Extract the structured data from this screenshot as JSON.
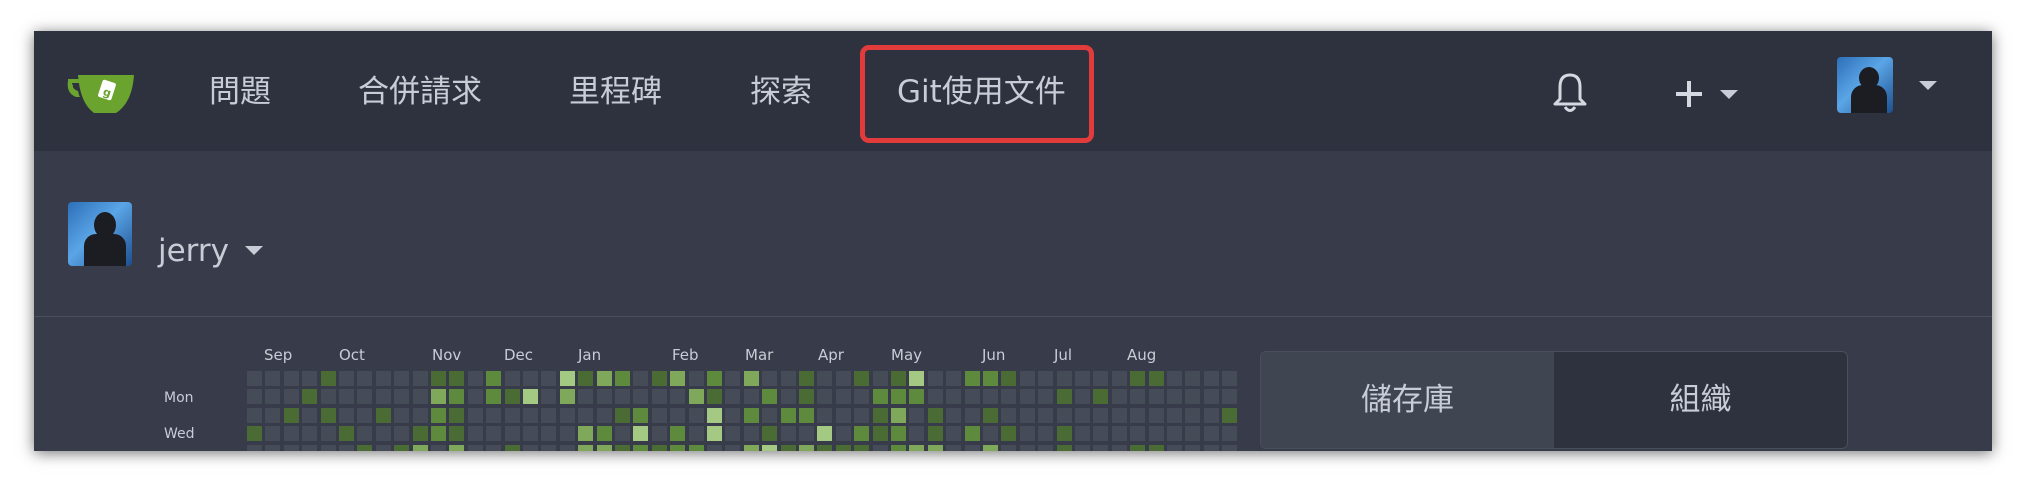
{
  "navbar": {
    "logo_icon": "gitea-teacup-icon",
    "items": [
      {
        "label": "問題"
      },
      {
        "label": "合併請求"
      },
      {
        "label": "里程碑"
      },
      {
        "label": "探索"
      },
      {
        "label": "Git使用文件",
        "highlighted": true
      }
    ],
    "notification_icon": "bell-icon",
    "create_icon": "plus-icon",
    "dropdown_icon": "caret-down-icon",
    "highlight_color": "#e23b3b"
  },
  "user": {
    "name": "jerry"
  },
  "heatmap": {
    "months": [
      "Sep",
      "Oct",
      "Nov",
      "Dec",
      "Jan",
      "Feb",
      "Mar",
      "Apr",
      "May",
      "Jun",
      "Jul",
      "Aug"
    ],
    "day_labels": [
      "Mon",
      "Wed"
    ],
    "colors": [
      "#454b57",
      "#4a6b33",
      "#5d8a3c",
      "#7fa85a",
      "#a4c983"
    ]
  },
  "profile_tabs": {
    "items": [
      {
        "label": "儲存庫",
        "active": true
      },
      {
        "label": "組織",
        "active": false
      }
    ]
  },
  "colors": {
    "navbar_bg": "#2e323e",
    "page_bg": "#383c4a",
    "text": "#c8ccd6"
  }
}
